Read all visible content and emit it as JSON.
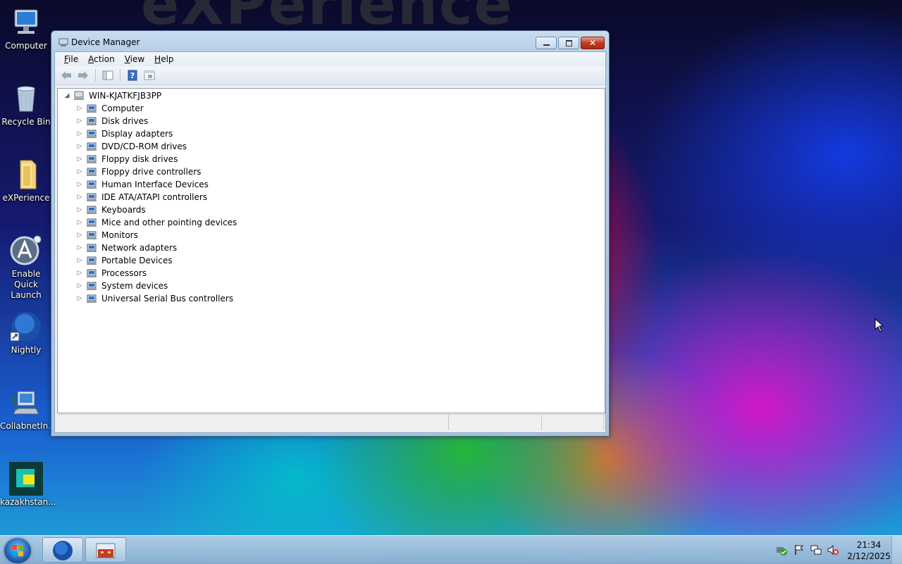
{
  "desktop": {
    "background_text": "eXPerience",
    "icons": [
      {
        "label": "Computer",
        "icon": "computer-icon"
      },
      {
        "label": "Recycle Bin",
        "icon": "recycle-bin-icon"
      },
      {
        "label": "eXPerience",
        "icon": "folder-icon"
      },
      {
        "label": "Enable Quick Launch",
        "icon": "quick-launch-icon"
      },
      {
        "label": "Nightly",
        "icon": "browser-globe-icon"
      },
      {
        "label": "CollabnetIn...",
        "icon": "network-computer-icon"
      },
      {
        "label": "kazakhstan...",
        "icon": "app-tile-icon"
      }
    ]
  },
  "window": {
    "title": "Device Manager",
    "buttons": {
      "minimize": "minimize",
      "maximize": "maximize",
      "close": "✕"
    },
    "menu": [
      "File",
      "Action",
      "View",
      "Help"
    ],
    "toolbar": [
      "back-arrow-icon",
      "forward-arrow-icon",
      "show-hide-console-tree-icon",
      "help-icon",
      "properties-icon"
    ],
    "tree": {
      "root": "WIN-KJATKFJB3PP",
      "items": [
        "Computer",
        "Disk drives",
        "Display adapters",
        "DVD/CD-ROM drives",
        "Floppy disk drives",
        "Floppy drive controllers",
        "Human Interface Devices",
        "IDE ATA/ATAPI controllers",
        "Keyboards",
        "Mice and other pointing devices",
        "Monitors",
        "Network adapters",
        "Portable Devices",
        "Processors",
        "System devices",
        "Universal Serial Bus controllers"
      ]
    }
  },
  "taskbar": {
    "clock_time": "21:34",
    "clock_date": "2/12/2025",
    "pinned": [
      "browser-globe-icon",
      "device-manager-toolbox-icon"
    ],
    "tray": [
      "security-shield-icon",
      "action-center-flag-icon",
      "network-icon",
      "volume-muted-icon"
    ]
  },
  "colors": {
    "window_frame": "#a9c4e0",
    "close_button": "#c43a20",
    "taskbar": "#b4cde6"
  }
}
